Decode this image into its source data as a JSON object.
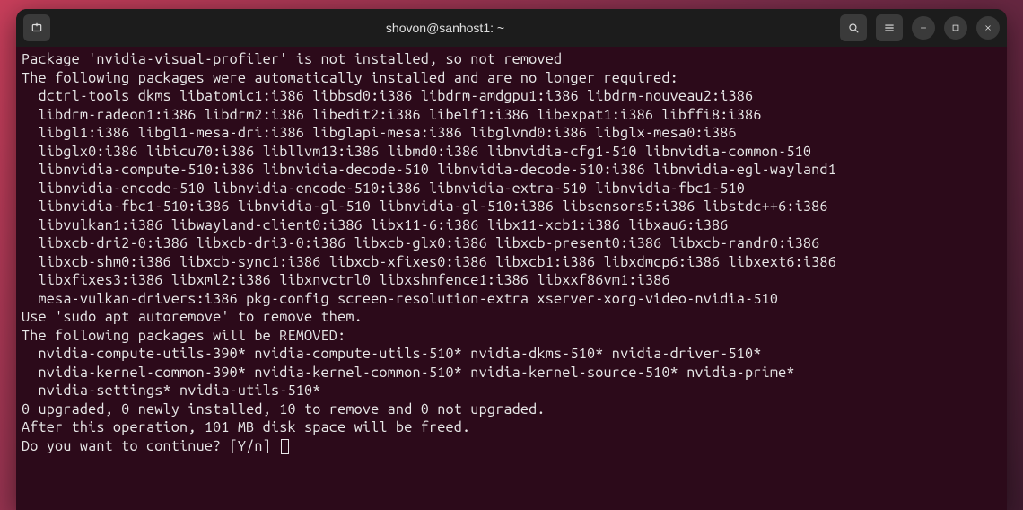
{
  "titlebar": {
    "title": "shovon@sanhost1: ~"
  },
  "terminal": {
    "lines": [
      "Package 'nvidia-visual-profiler' is not installed, so not removed",
      "The following packages were automatically installed and are no longer required:",
      "  dctrl-tools dkms libatomic1:i386 libbsd0:i386 libdrm-amdgpu1:i386 libdrm-nouveau2:i386",
      "  libdrm-radeon1:i386 libdrm2:i386 libedit2:i386 libelf1:i386 libexpat1:i386 libffi8:i386",
      "  libgl1:i386 libgl1-mesa-dri:i386 libglapi-mesa:i386 libglvnd0:i386 libglx-mesa0:i386",
      "  libglx0:i386 libicu70:i386 libllvm13:i386 libmd0:i386 libnvidia-cfg1-510 libnvidia-common-510",
      "  libnvidia-compute-510:i386 libnvidia-decode-510 libnvidia-decode-510:i386 libnvidia-egl-wayland1",
      "  libnvidia-encode-510 libnvidia-encode-510:i386 libnvidia-extra-510 libnvidia-fbc1-510",
      "  libnvidia-fbc1-510:i386 libnvidia-gl-510 libnvidia-gl-510:i386 libsensors5:i386 libstdc++6:i386",
      "  libvulkan1:i386 libwayland-client0:i386 libx11-6:i386 libx11-xcb1:i386 libxau6:i386",
      "  libxcb-dri2-0:i386 libxcb-dri3-0:i386 libxcb-glx0:i386 libxcb-present0:i386 libxcb-randr0:i386",
      "  libxcb-shm0:i386 libxcb-sync1:i386 libxcb-xfixes0:i386 libxcb1:i386 libxdmcp6:i386 libxext6:i386",
      "  libxfixes3:i386 libxml2:i386 libxnvctrl0 libxshmfence1:i386 libxxf86vm1:i386",
      "  mesa-vulkan-drivers:i386 pkg-config screen-resolution-extra xserver-xorg-video-nvidia-510",
      "Use 'sudo apt autoremove' to remove them.",
      "The following packages will be REMOVED:",
      "  nvidia-compute-utils-390* nvidia-compute-utils-510* nvidia-dkms-510* nvidia-driver-510*",
      "  nvidia-kernel-common-390* nvidia-kernel-common-510* nvidia-kernel-source-510* nvidia-prime*",
      "  nvidia-settings* nvidia-utils-510*",
      "0 upgraded, 0 newly installed, 10 to remove and 0 not upgraded.",
      "After this operation, 101 MB disk space will be freed.",
      "Do you want to continue? [Y/n] "
    ]
  }
}
